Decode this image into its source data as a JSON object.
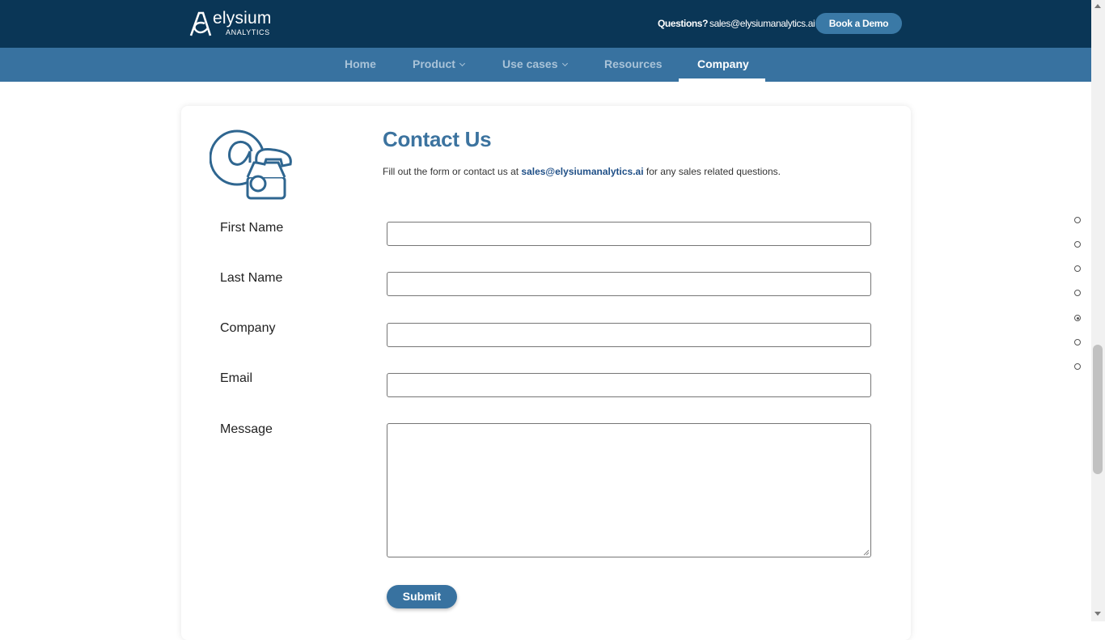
{
  "header": {
    "logo_word": "elysium",
    "logo_sub": "ANALYTICS",
    "questions_label": "Questions?",
    "email": "sales@elysiumanalytics.ai",
    "demo_button": "Book a Demo"
  },
  "nav": {
    "items": [
      {
        "label": "Home",
        "has_dropdown": false,
        "active": false
      },
      {
        "label": "Product",
        "has_dropdown": true,
        "active": false
      },
      {
        "label": "Use cases",
        "has_dropdown": true,
        "active": false
      },
      {
        "label": "Resources",
        "has_dropdown": false,
        "active": false
      },
      {
        "label": "Company",
        "has_dropdown": false,
        "active": true
      }
    ]
  },
  "contact": {
    "icon": "at-sign-telephone-icon",
    "heading": "Contact Us",
    "intro_before": "Fill out the form or contact us at ",
    "intro_email": "sales@elysiumanalytics.ai",
    "intro_after": " for any sales related questions."
  },
  "form": {
    "fields": [
      {
        "label": "First Name",
        "value": ""
      },
      {
        "label": "Last Name",
        "value": ""
      },
      {
        "label": "Company",
        "value": ""
      },
      {
        "label": "Email",
        "value": ""
      },
      {
        "label": "Message",
        "value": ""
      }
    ],
    "submit_label": "Submit"
  },
  "section_dots": {
    "count": 7,
    "active_index": 4
  },
  "colors": {
    "topbar": "#0a3656",
    "navbar": "#3872a0",
    "accent": "#3c739f",
    "nav_inactive_text": "#a9c3d8"
  }
}
